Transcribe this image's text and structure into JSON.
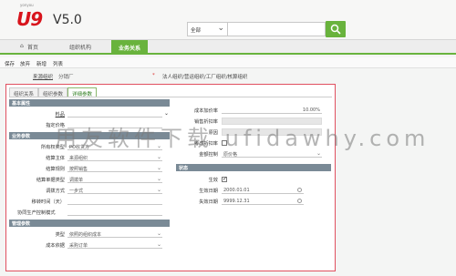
{
  "header": {
    "logo_sub": "yonyou",
    "logo": "U9",
    "version": "V5.0",
    "scope": "全部",
    "search_value": ""
  },
  "nav": {
    "home": "首页",
    "org": "组织机构",
    "business": "业务关系"
  },
  "toolbar": {
    "save": "保存",
    "abandon": "放弃",
    "new": "新增",
    "list": "列表"
  },
  "filter": {
    "source_org_label": "来源组织",
    "source_org_value": "分销厂",
    "required_mark": "*",
    "target_label": "法人组织/营运组织/工厂组织/核算组织"
  },
  "tabs": [
    "组织关系",
    "组织参数",
    "详细参数"
  ],
  "sections": {
    "basic": "基本属性",
    "business": "业务参数",
    "mgmt": "管理参数",
    "status": "状态"
  },
  "left_fields": {
    "item_label": "料品",
    "item_value": "",
    "price_label": "指定价格",
    "price_value": "",
    "owner_label": "所有权类型",
    "owner_value": "PO收货方",
    "settle_subject_label": "结算主体",
    "settle_subject_value": "来源组织",
    "settle_rule_label": "结算规则",
    "settle_rule_value": "按照销售",
    "settle_type_label": "结算单据类型",
    "settle_type_value": "调拨单",
    "transfer_label": "调拨方式",
    "transfer_value": "一步式",
    "move_time_label": "移转时间（天）",
    "move_time_value": "",
    "coop_mode_label": "协同生产控制模式",
    "coop_mode_value": "",
    "type_label": "类型",
    "type_value": "依照的组织成本",
    "cost_basis_label": "成本依据",
    "cost_basis_value": "采购订单"
  },
  "right_fields": {
    "cost_markup_label": "成本加价率",
    "cost_markup_value": "10.00%",
    "sales_discount_label": "销售折扣率",
    "sales_discount_value": "",
    "reason_label": "原因",
    "reason_value": "",
    "consider_discount_label": "考虑折扣率",
    "amount_mode_label": "金额控制",
    "amount_mode_value": "原价格",
    "effective_label": "生效",
    "effective_checked": true,
    "eff_date_label": "生效日期",
    "eff_date_value": "2000.01.01",
    "exp_date_label": "失效日期",
    "exp_date_value": "9999.12.31"
  },
  "watermark": "用友软件下载  ufidawhy.com",
  "colors": {
    "brand_red": "#d8141c",
    "accent_green": "#69b33d",
    "highlight_red": "#e05060",
    "section_grey": "#7a8a96"
  }
}
